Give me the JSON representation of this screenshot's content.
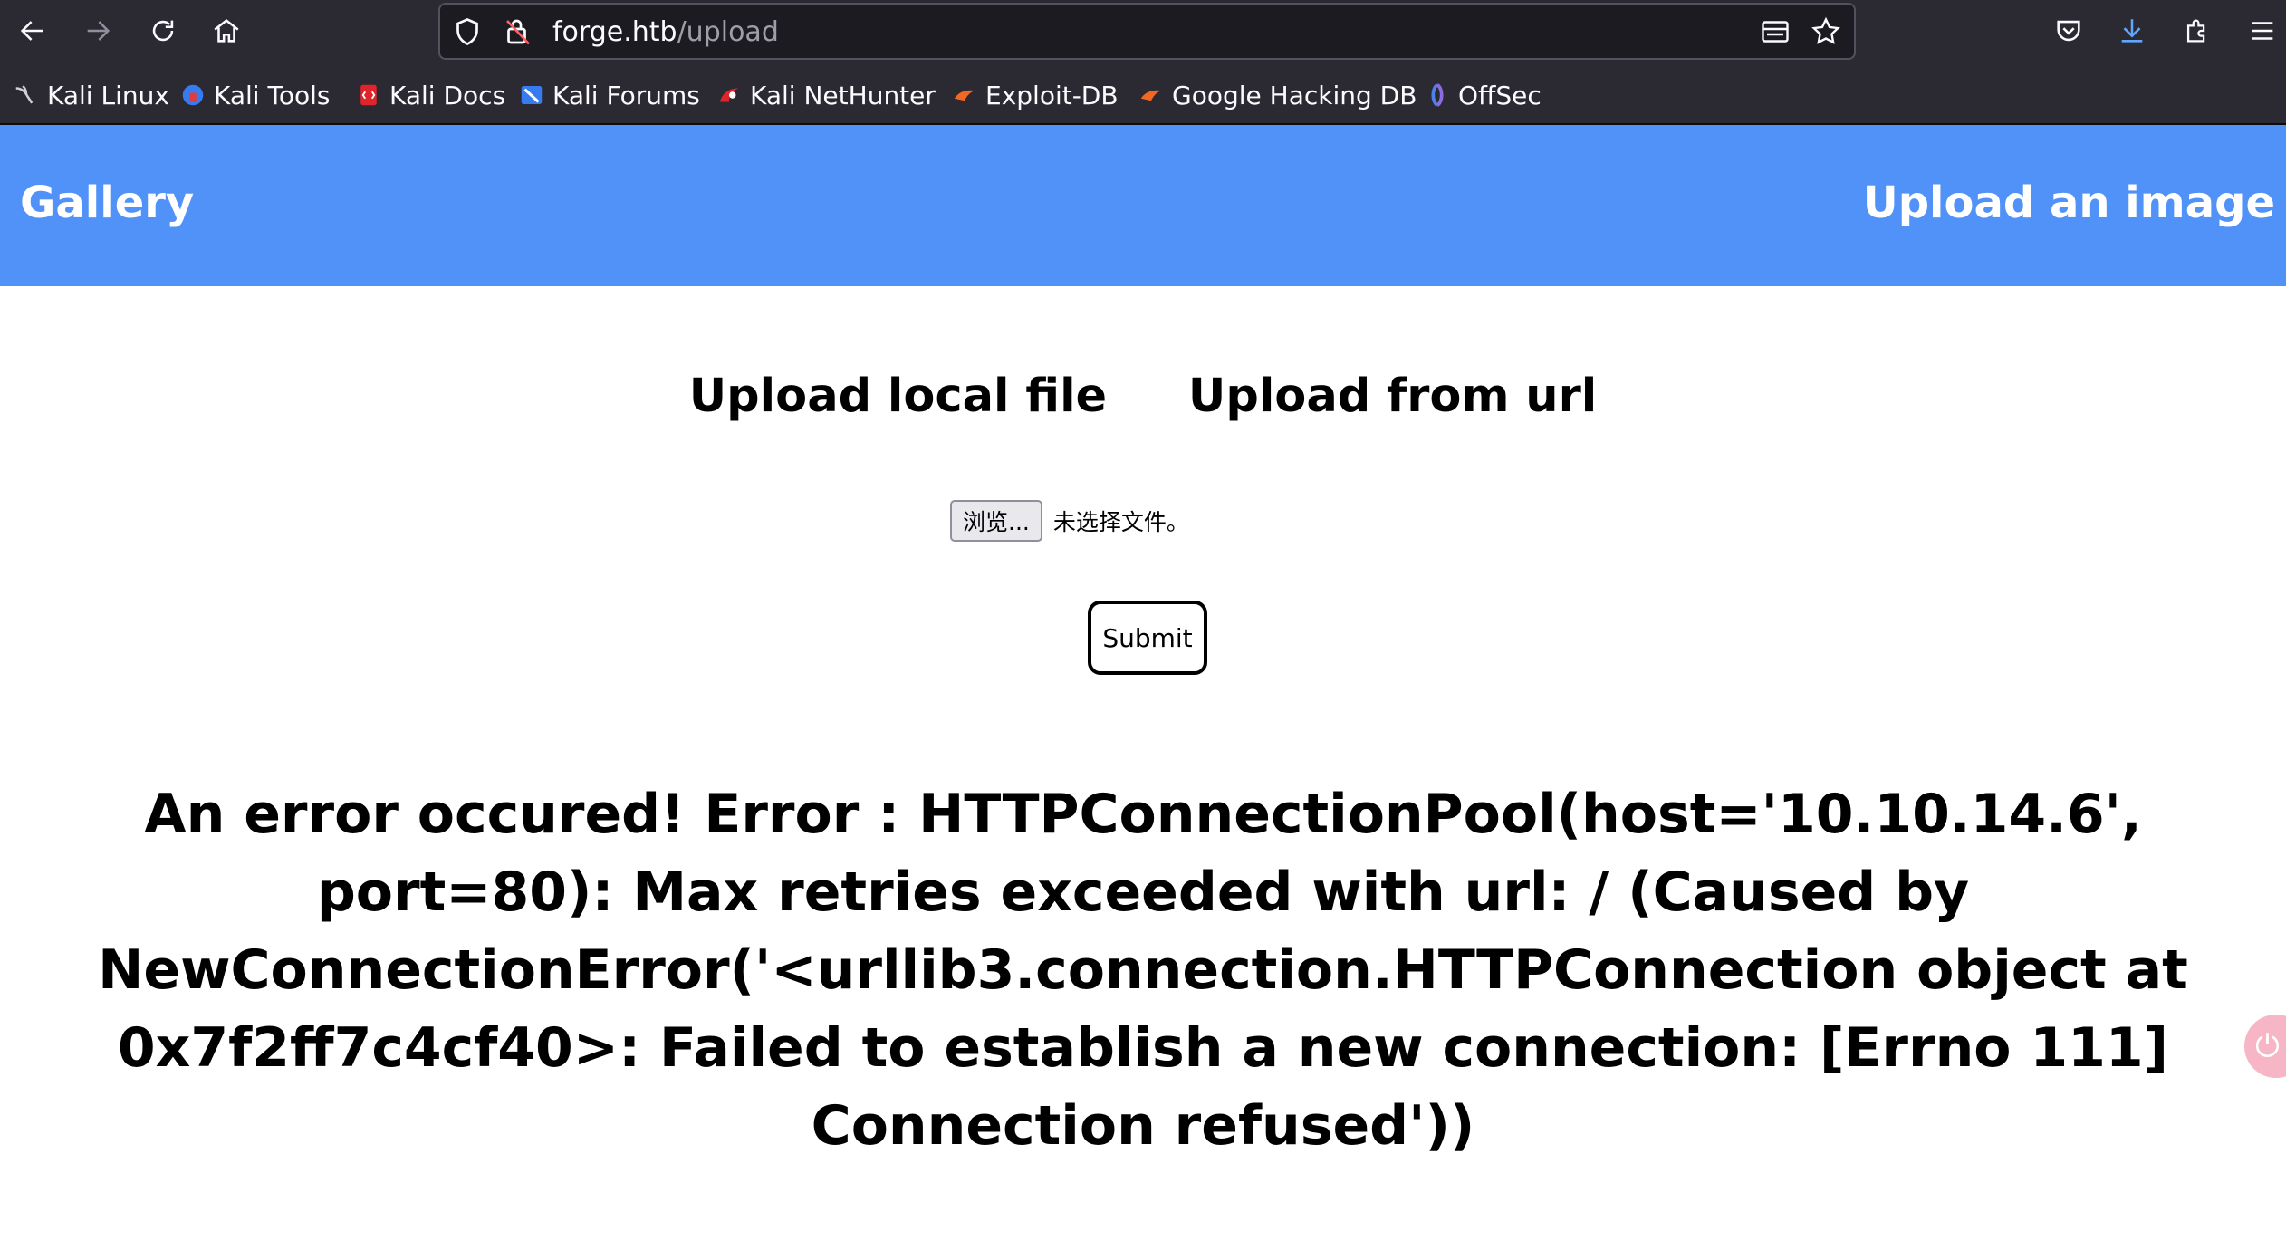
{
  "browser": {
    "url_host": "forge.htb",
    "url_path": "/upload",
    "bookmarks": [
      {
        "label": "Kali Linux",
        "icon": "kali-dragon-icon"
      },
      {
        "label": "Kali Tools",
        "icon": "kali-tools-icon"
      },
      {
        "label": "Kali Docs",
        "icon": "kali-docs-icon"
      },
      {
        "label": "Kali Forums",
        "icon": "kali-forums-icon"
      },
      {
        "label": "Kali NetHunter",
        "icon": "kali-nethunter-icon"
      },
      {
        "label": "Exploit-DB",
        "icon": "exploit-db-icon"
      },
      {
        "label": "Google Hacking DB",
        "icon": "ghdb-icon"
      },
      {
        "label": "OffSec",
        "icon": "offsec-icon"
      }
    ]
  },
  "nav": {
    "brand": "Gallery",
    "upload_link": "Upload an image"
  },
  "upload": {
    "tab_local": "Upload local file",
    "tab_url": "Upload from url",
    "browse_label": "浏览...",
    "no_file_text": "未选择文件。",
    "submit_label": "Submit"
  },
  "error": {
    "message": "An error occured! Error : HTTPConnectionPool(host='10.10.14.6', port=80): Max retries exceeded with url: / (Caused by NewConnectionError('<urllib3.connection.HTTPConnection object at 0x7f2ff7c4cf40>: Failed to establish a new connection: [Errno 111] Connection refused'))"
  },
  "colors": {
    "nav_background": "#5092f7",
    "chrome_background": "#2b2a33",
    "urlbar_background": "#1c1b22"
  }
}
